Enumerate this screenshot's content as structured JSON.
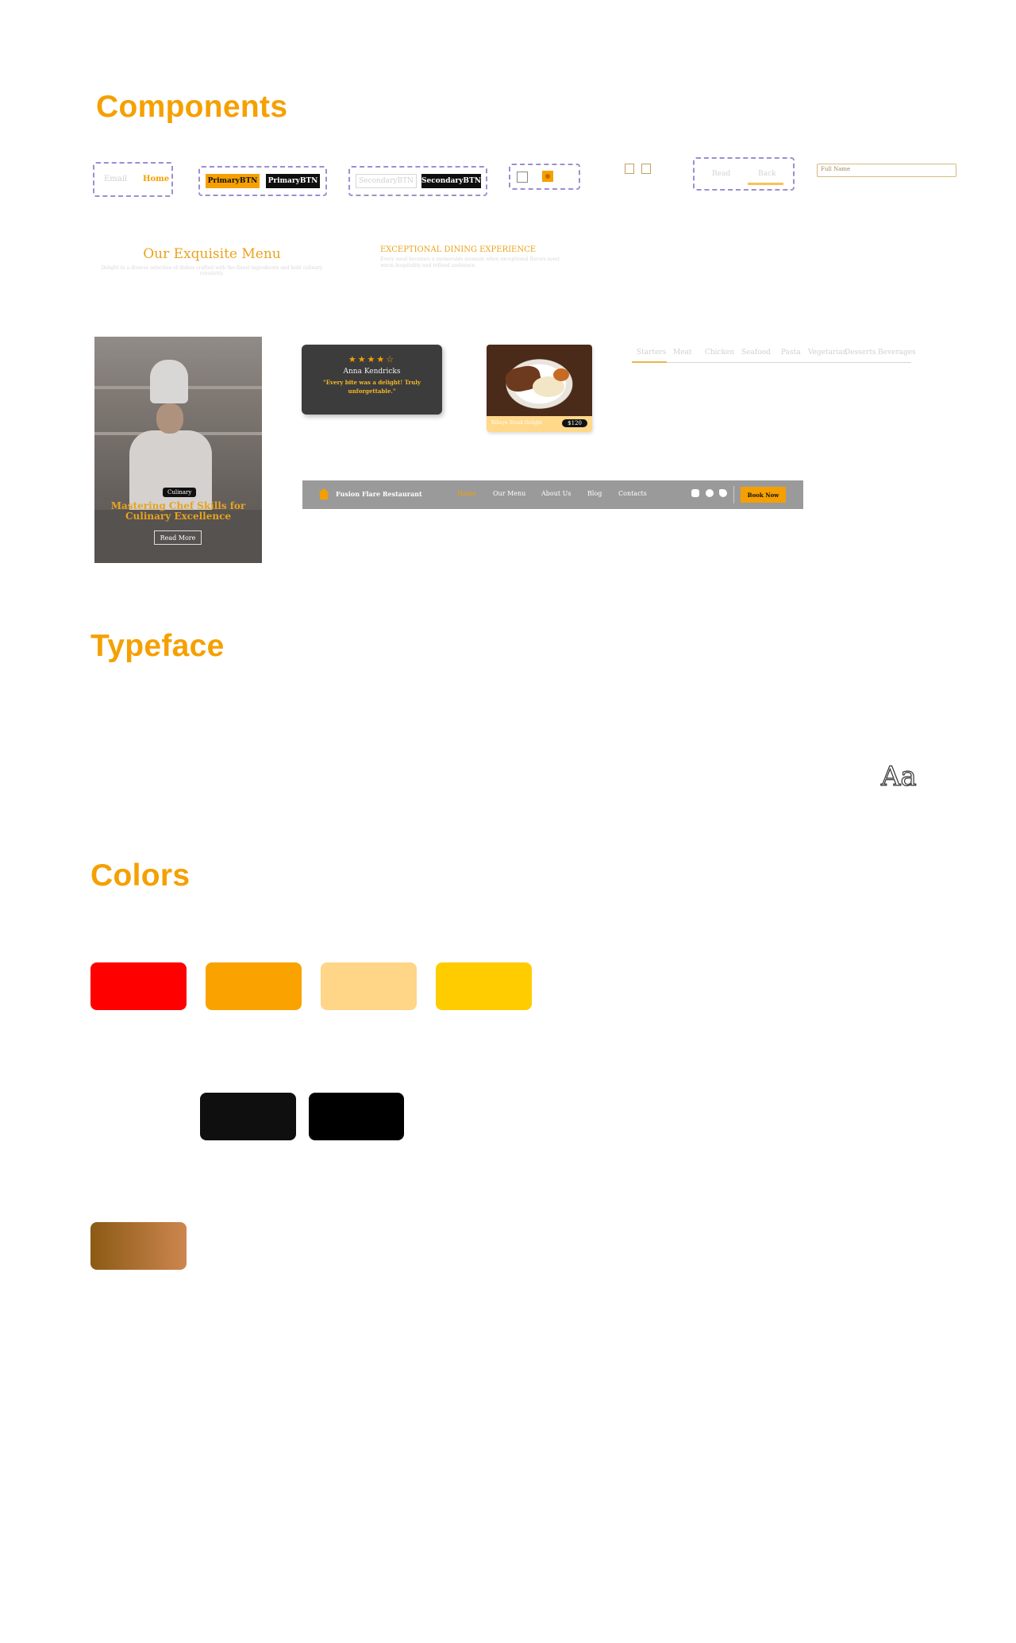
{
  "sections": {
    "components": "Components",
    "typeface": "Typeface",
    "colors": "Colors"
  },
  "nav_example": {
    "item1": "Email",
    "item2": "Home"
  },
  "buttons": {
    "primary_1": "PrimaryBTN",
    "primary_2": "PrimaryBTN",
    "secondary_1": "SecondaryBTN",
    "secondary_2": "SecondaryBTN"
  },
  "tabs_example": {
    "tab1": "Read",
    "tab2": "Back"
  },
  "input_example": {
    "placeholder": "Full Name"
  },
  "headings": {
    "menu_title": "Our Exquisite Menu",
    "menu_sub": "Delight in a diverse selection of dishes crafted with the finest ingredients and bold culinary creativity.",
    "exp_title": "EXCEPTIONAL DINING EXPERIENCE",
    "exp_sub": "Every meal becomes a memorable moment when exceptional flavors meet warm hospitality and refined ambience."
  },
  "blog_card": {
    "tag": "Culinary",
    "title": "Mastering Chef Skills for Culinary Excellence",
    "button": "Read More"
  },
  "review_card": {
    "stars": "★★★★☆",
    "name": "Anna Kendricks",
    "quote": "\"Every bite was a delight! Truly unforgettable.\""
  },
  "dish_card": {
    "name": "Ribeye Steak Delight",
    "price": "$120"
  },
  "filter_tabs": [
    "Starters",
    "Meat",
    "Chicken",
    "Seafood",
    "Pasta",
    "Vegetarian",
    "Desserts",
    "Beverages"
  ],
  "navbar": {
    "brand": "Fusion Flare Restaurant",
    "links": [
      "Home",
      "Our Menu",
      "About Us",
      "Blog",
      "Contacts"
    ],
    "active": "Home",
    "social": [
      "instagram-icon",
      "facebook-icon",
      "twitter-icon"
    ],
    "cta": "Book Now"
  },
  "typeface": {
    "sample": "Aa"
  },
  "colors": {
    "row1": [
      "#ff0000",
      "#f9a200",
      "#ffd587",
      "#ffcc00"
    ],
    "row2": [
      "#0f0f0f",
      "#000000"
    ],
    "gradient": [
      "#8b5a14",
      "#cd8650"
    ]
  }
}
